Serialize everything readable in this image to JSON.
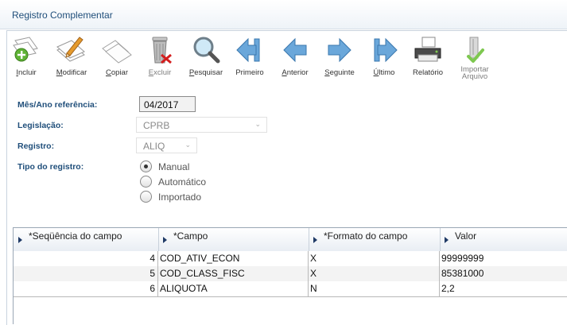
{
  "window": {
    "title": "Registro Complementar"
  },
  "toolbar": {
    "items": [
      {
        "label": "Incluir",
        "ul": "I",
        "rest": "ncluir",
        "enabled": true
      },
      {
        "label": "Modificar",
        "ul": "M",
        "rest": "odificar",
        "enabled": true
      },
      {
        "label": "Copiar",
        "ul": "C",
        "rest": "opiar",
        "enabled": true
      },
      {
        "label": "Excluir",
        "ul": "E",
        "rest": "xcluir",
        "enabled": false
      },
      {
        "label": "Pesquisar",
        "ul": "P",
        "rest": "esquisar",
        "enabled": true
      },
      {
        "label": "Primeiro",
        "enabled": true
      },
      {
        "label": "Anterior",
        "ul": "A",
        "rest": "nterior",
        "enabled": true
      },
      {
        "label": "Seguinte",
        "ul": "S",
        "rest": "eguinte",
        "enabled": true
      },
      {
        "label": "Último",
        "ul": "Ú",
        "rest": "ltimo",
        "enabled": true
      },
      {
        "label": "Relatório",
        "enabled": true
      },
      {
        "label": "Importar Arquivo",
        "line1": "Importar",
        "line2": "Arquivo",
        "enabled": false
      }
    ]
  },
  "form": {
    "mes_ano_label": "Mês/Ano referência:",
    "mes_ano_value": "04/2017",
    "legislacao_label": "Legislação:",
    "legislacao_value": "CPRB",
    "registro_label": "Registro:",
    "registro_value": "ALIQ",
    "tipo_label": "Tipo do registro:",
    "tipo_options": [
      "Manual",
      "Automático",
      "Importado"
    ],
    "tipo_selected": "Manual"
  },
  "grid": {
    "columns": [
      "*Seqüência do campo",
      "*Campo",
      "*Formato do campo",
      "Valor"
    ],
    "rows": [
      [
        "4",
        "COD_ATIV_ECON",
        "X",
        "99999999"
      ],
      [
        "5",
        "COD_CLASS_FISC",
        "X",
        "85381000"
      ],
      [
        "6",
        "ALIQUOTA",
        "N",
        "2,2"
      ]
    ]
  }
}
